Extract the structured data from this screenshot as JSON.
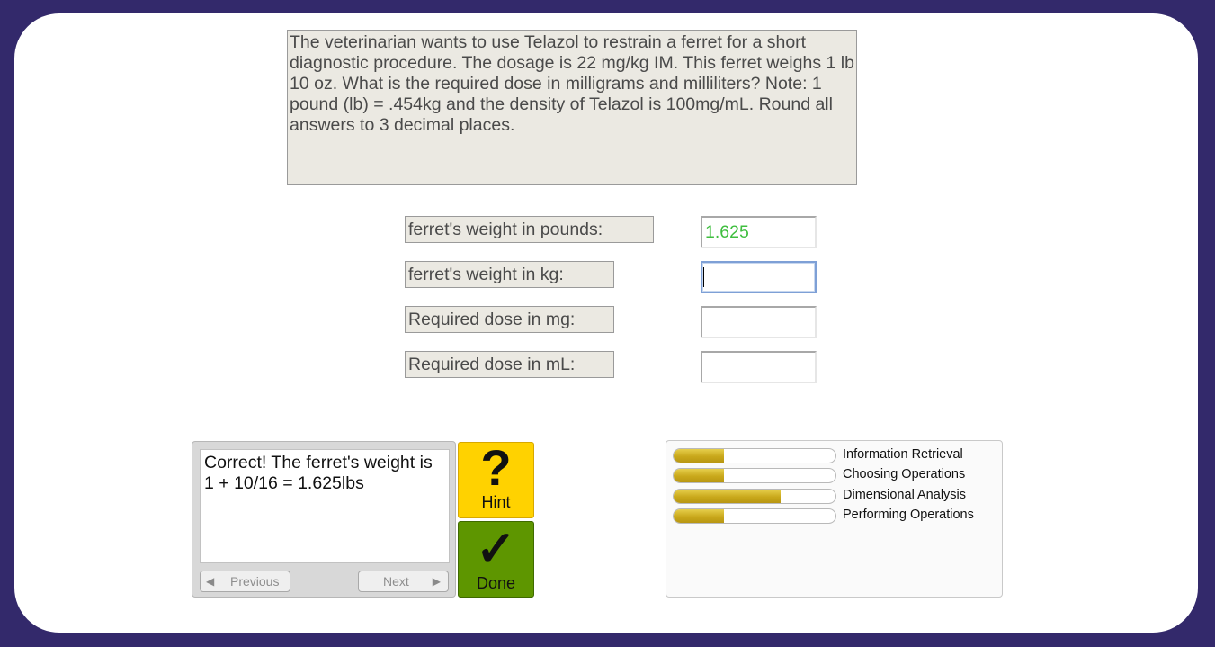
{
  "problem": {
    "text": "The veterinarian wants to use Telazol to restrain a ferret for a short diagnostic procedure. The dosage is 22 mg/kg IM. This ferret weighs 1 lb 10 oz. What is the required dose in milligrams and milliliters? Note: 1 pound (lb) = .454kg and the density of Telazol is 100mg/mL. Round all answers to 3 decimal places."
  },
  "fields": [
    {
      "label": "ferret's weight in pounds:",
      "value": "1.625",
      "status": "correct"
    },
    {
      "label": "ferret's weight in kg:",
      "value": "",
      "status": "focused"
    },
    {
      "label": "Required dose in mg:",
      "value": "",
      "status": "empty"
    },
    {
      "label": "Required dose in mL:",
      "value": "",
      "status": "empty"
    }
  ],
  "feedback": {
    "text": "Correct! The ferret's weight is 1 + 10/16 = 1.625lbs",
    "previous_label": "Previous",
    "next_label": "Next"
  },
  "buttons": {
    "hint_label": "Hint",
    "done_label": "Done"
  },
  "skills": [
    {
      "name": "Information Retrieval",
      "progress": 0.31
    },
    {
      "name": "Choosing Operations",
      "progress": 0.31
    },
    {
      "name": "Dimensional Analysis",
      "progress": 0.66
    },
    {
      "name": "Performing Operations",
      "progress": 0.31
    }
  ],
  "colors": {
    "background": "#33296b",
    "correct_text": "#3fbe3f",
    "hint_button": "#ffd200",
    "done_button": "#5e9600",
    "skill_bar": "#c9a81b"
  }
}
